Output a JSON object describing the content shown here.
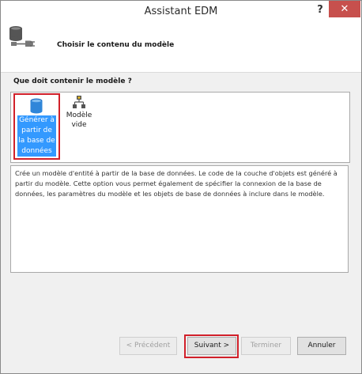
{
  "window": {
    "title": "Assistant EDM",
    "help_label": "?",
    "close_label": "✕"
  },
  "header": {
    "title": "Choisir le contenu du modèle"
  },
  "section": {
    "question": "Que doit contenir le modèle ?"
  },
  "choices": [
    {
      "label": "Générer à partir de la base de données",
      "icon": "database-icon",
      "selected": true
    },
    {
      "label": "Modèle vide",
      "icon": "empty-model-icon",
      "selected": false
    }
  ],
  "description": "Crée un modèle d'entité à partir de la base de données. Le code de la couche d'objets est généré à partir du modèle. Cette option vous permet également de spécifier la connexion de la base de données, les paramètres du modèle et les objets de base de données à inclure dans le modèle.",
  "buttons": {
    "previous": "< Précédent",
    "next": "Suivant >",
    "finish": "Terminer",
    "cancel": "Annuler"
  },
  "colors": {
    "selection": "#3399ff",
    "highlight_border": "#d1202a",
    "close_button": "#c7504d"
  }
}
